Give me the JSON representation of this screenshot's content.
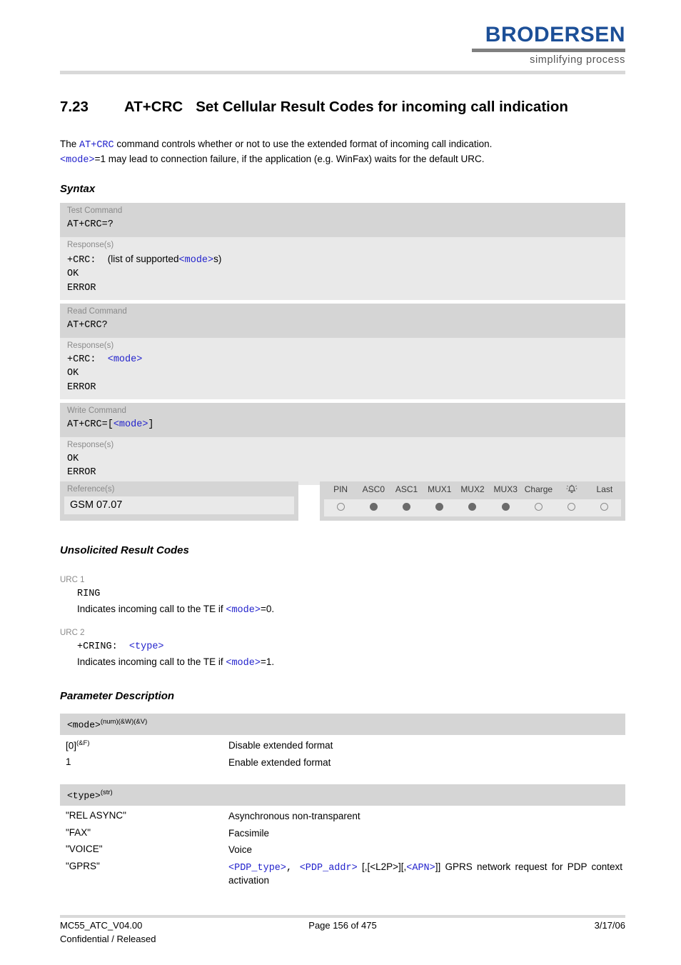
{
  "header": {
    "logo_word": "BRODERSEN",
    "logo_tagline": "simplifying process"
  },
  "title": {
    "number": "7.23",
    "command": "AT+CRC",
    "text": "Set Cellular Result Codes for incoming call indication"
  },
  "intro": {
    "part1": "The ",
    "cmd": "AT+CRC",
    "part2": " command controls whether or not to use the extended format of incoming call indication.",
    "mode_token": "<mode>",
    "part3": "=1 may lead to connection failure, if the application (e.g. WinFax) waits for the default URC."
  },
  "sections": {
    "syntax": "Syntax",
    "urc": "Unsolicited Result Codes",
    "parameters": "Parameter Description"
  },
  "syntax": {
    "test": {
      "label": "Test Command",
      "value": "AT+CRC=?",
      "response_label": "Response(s)",
      "response_prefix": "+CRC:",
      "response_text": "(list of supported",
      "response_param": "<mode>",
      "response_suffix": "s)",
      "ok": "OK",
      "error": "ERROR"
    },
    "read": {
      "label": "Read Command",
      "value": "AT+CRC?",
      "response_label": "Response(s)",
      "response_prefix": "+CRC:",
      "response_param": "<mode>",
      "ok": "OK",
      "error": "ERROR"
    },
    "write": {
      "label": "Write Command",
      "value_prefix": "AT+CRC=[",
      "value_param": "<mode>",
      "value_suffix": "]",
      "response_label": "Response(s)",
      "ok": "OK",
      "error": "ERROR"
    }
  },
  "reference": {
    "label": "Reference(s)",
    "value": "GSM 07.07"
  },
  "status": {
    "columns": [
      {
        "label": "PIN",
        "state": "off"
      },
      {
        "label": "ASC0",
        "state": "on"
      },
      {
        "label": "ASC1",
        "state": "on"
      },
      {
        "label": "MUX1",
        "state": "on"
      },
      {
        "label": "MUX2",
        "state": "on"
      },
      {
        "label": "MUX3",
        "state": "on"
      },
      {
        "label": "Charge",
        "state": "off"
      },
      {
        "label": "",
        "state": "off",
        "icon": "alarm-bell-icon"
      },
      {
        "label": "Last",
        "state": "off"
      }
    ]
  },
  "urc": [
    {
      "label": "URC 1",
      "code": "RING",
      "desc_prefix": "Indicates incoming call to the TE if ",
      "desc_param": "<mode>",
      "desc_suffix": "=0."
    },
    {
      "label": "URC 2",
      "code_prefix": "+CRING:",
      "code_param": "<type>",
      "desc_prefix": "Indicates incoming call to the TE if ",
      "desc_param": "<mode>",
      "desc_suffix": "=1."
    }
  ],
  "param_mode": {
    "name": "<mode>",
    "sup": "(num)(&W)(&V)",
    "rows": [
      {
        "key": "[0]",
        "key_sup": "(&F)",
        "value": "Disable extended format"
      },
      {
        "key": "1",
        "key_sup": "",
        "value": "Enable extended format"
      }
    ]
  },
  "param_type": {
    "name": "<type>",
    "sup": "(str)",
    "rows": [
      {
        "key": "\"REL ASYNC\"",
        "value": "Asynchronous non-transparent"
      },
      {
        "key": "\"FAX\"",
        "value": "Facsimile"
      },
      {
        "key": "\"VOICE\"",
        "value": "Voice"
      }
    ],
    "gprs": {
      "key": "\"GPRS\"",
      "p1": "<PDP_type>",
      "sep1": ", ",
      "p2": "<PDP_addr>",
      "mid": " [,[<L2P>][,",
      "p3": "<APN>",
      "tail": "]] GPRS network request for PDP context activation"
    }
  },
  "footer": {
    "left_line1": "MC55_ATC_V04.00",
    "left_line2": "Confidential / Released",
    "center": "Page 156 of 475",
    "right": "3/17/06"
  },
  "colors": {
    "brand_blue": "#1c4f97",
    "param_blue": "#2222cc",
    "band_command": "#d5d5d5",
    "band_response": "#e9e9e9",
    "rule_gray": "#d9d9d9"
  }
}
